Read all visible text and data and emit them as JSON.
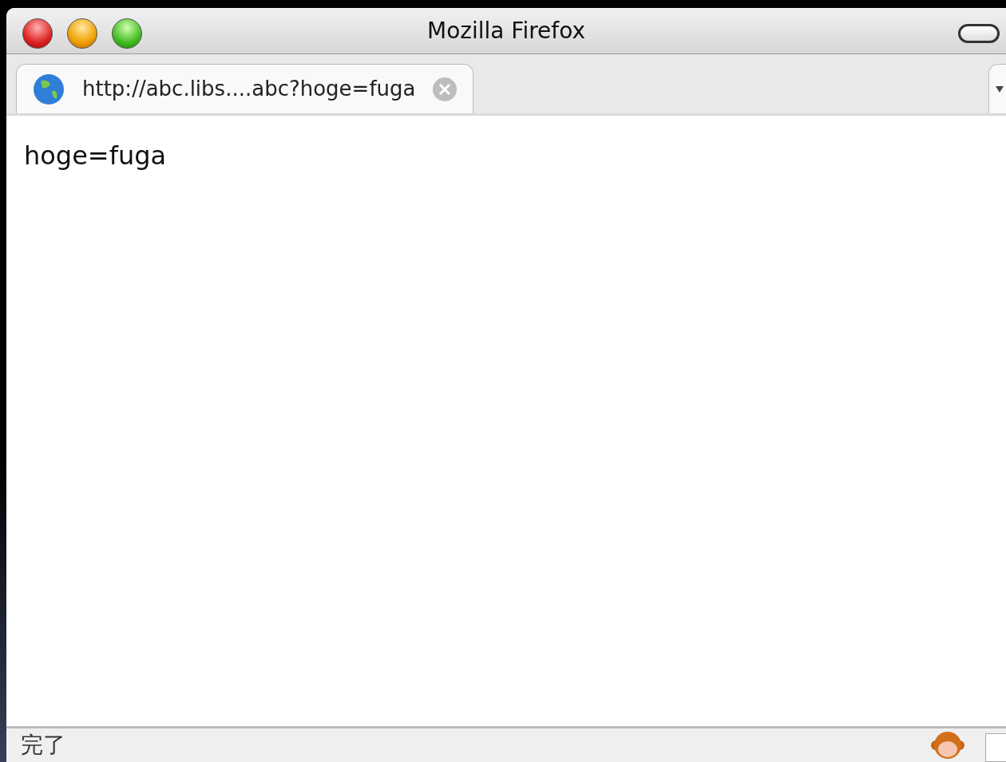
{
  "window": {
    "title": "Mozilla Firefox"
  },
  "tabs": [
    {
      "label": "http://abc.libs....abc?hoge=fuga",
      "selected": true
    }
  ],
  "content": {
    "text": "hoge=fuga"
  },
  "status_bar": {
    "text": "完了"
  }
}
